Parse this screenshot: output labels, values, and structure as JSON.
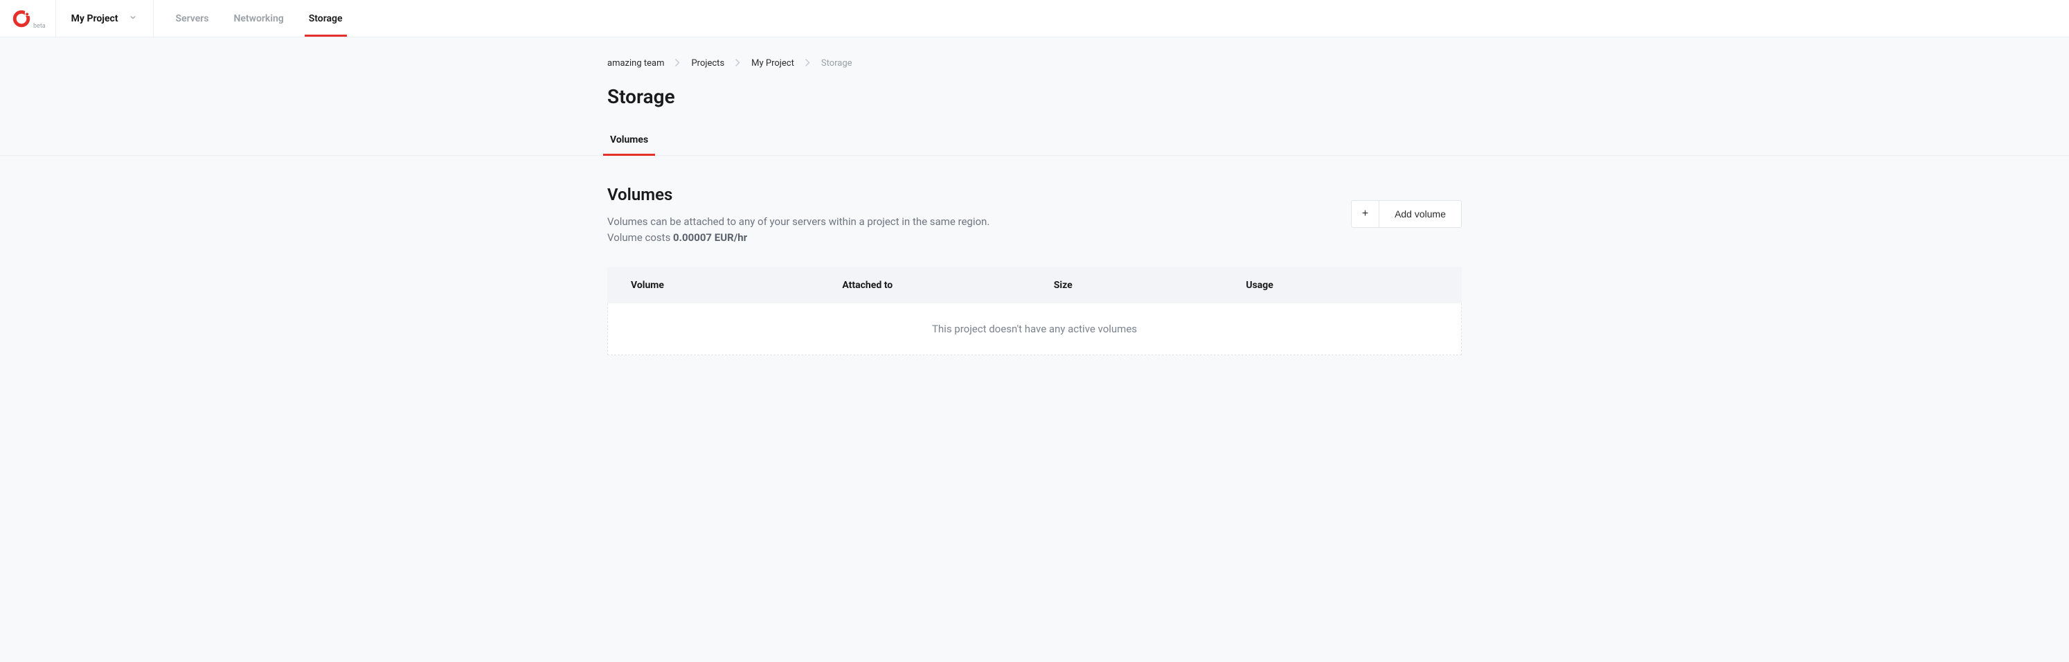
{
  "logo_beta": "beta",
  "project_name": "My Project",
  "nav": {
    "servers": "Servers",
    "networking": "Networking",
    "storage": "Storage"
  },
  "breadcrumb": {
    "team": "amazing team",
    "projects": "Projects",
    "project": "My Project",
    "current": "Storage"
  },
  "page_title": "Storage",
  "sub_tabs": {
    "volumes": "Volumes"
  },
  "section": {
    "title": "Volumes",
    "desc_line1": "Volumes can be attached to any of your servers within a project in the same region.",
    "desc_cost_prefix": "Volume costs ",
    "desc_cost_value": "0.00007 EUR/hr"
  },
  "add_button": "Add volume",
  "table": {
    "cols": {
      "volume": "Volume",
      "attached_to": "Attached to",
      "size": "Size",
      "usage": "Usage"
    },
    "empty": "This project doesn't have any active volumes"
  }
}
